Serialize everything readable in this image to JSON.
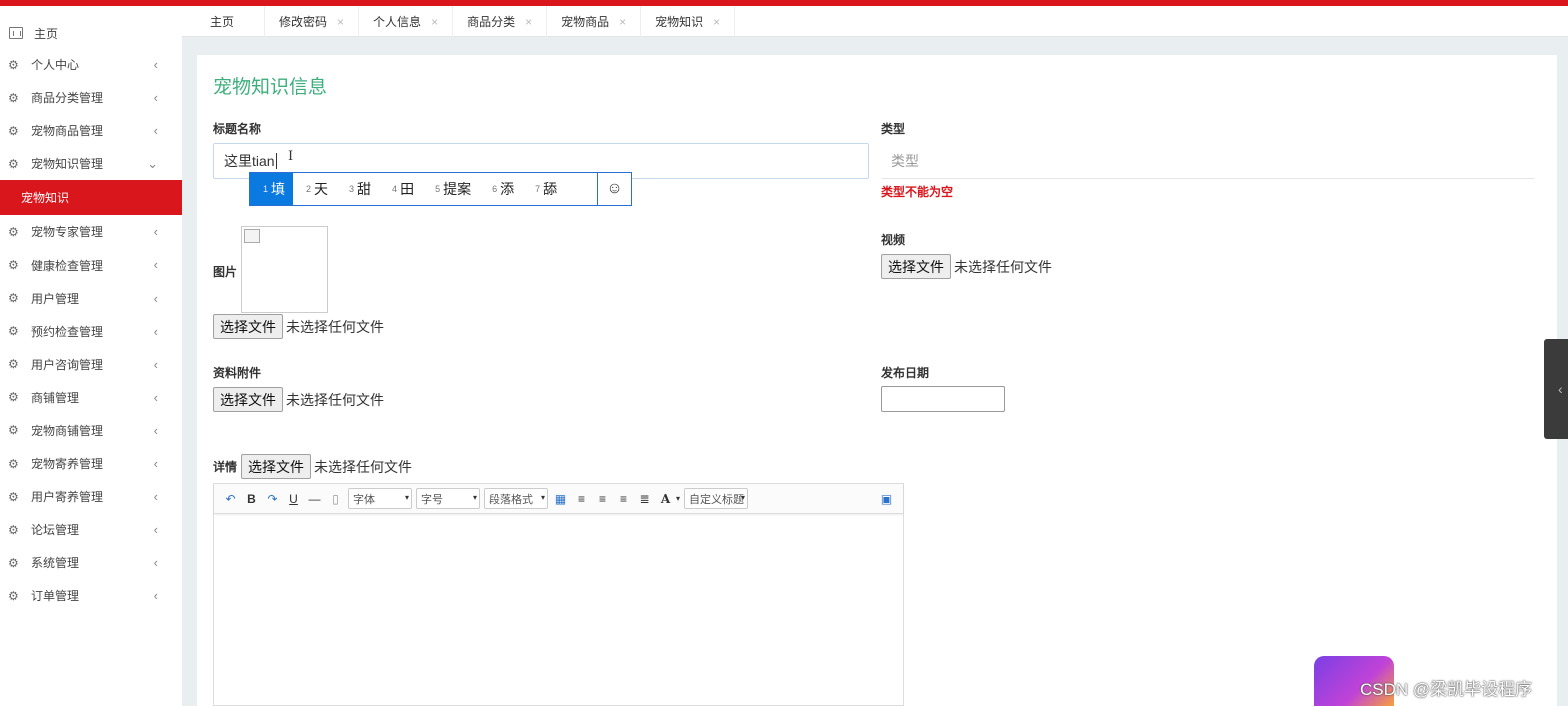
{
  "colors": {
    "accent_red": "#d9161c",
    "title_green": "#3eaf7c",
    "main_bg": "#e9eef0",
    "ime_blue": "#0b7ae0"
  },
  "sidebar": {
    "home": {
      "label": "主页",
      "icon": "dashboard-icon"
    },
    "items": [
      {
        "label": "个人中心",
        "icon": "gear-icon",
        "chevron": "chevron-left-icon"
      },
      {
        "label": "商品分类管理",
        "icon": "gear-icon",
        "chevron": "chevron-left-icon"
      },
      {
        "label": "宠物商品管理",
        "icon": "gear-icon",
        "chevron": "chevron-left-icon"
      },
      {
        "label": "宠物知识管理",
        "icon": "gear-icon",
        "chevron": "chevron-down-icon"
      },
      {
        "label": "宠物知识",
        "sub": true
      },
      {
        "label": "宠物专家管理",
        "icon": "gear-icon",
        "chevron": "chevron-left-icon"
      },
      {
        "label": "健康检查管理",
        "icon": "gear-icon",
        "chevron": "chevron-left-icon"
      },
      {
        "label": "用户管理",
        "icon": "gear-icon",
        "chevron": "chevron-left-icon"
      },
      {
        "label": "预约检查管理",
        "icon": "gear-icon",
        "chevron": "chevron-left-icon"
      },
      {
        "label": "用户咨询管理",
        "icon": "gear-icon",
        "chevron": "chevron-left-icon"
      },
      {
        "label": "商铺管理",
        "icon": "gear-icon",
        "chevron": "chevron-left-icon"
      },
      {
        "label": "宠物商铺管理",
        "icon": "gear-icon",
        "chevron": "chevron-left-icon"
      },
      {
        "label": "宠物寄养管理",
        "icon": "gear-icon",
        "chevron": "chevron-left-icon"
      },
      {
        "label": "用户寄养管理",
        "icon": "gear-icon",
        "chevron": "chevron-left-icon"
      },
      {
        "label": "论坛管理",
        "icon": "gear-icon",
        "chevron": "chevron-left-icon"
      },
      {
        "label": "系统管理",
        "icon": "gear-icon",
        "chevron": "chevron-left-icon"
      },
      {
        "label": "订单管理",
        "icon": "gear-icon",
        "chevron": "chevron-left-icon"
      }
    ]
  },
  "tabs": [
    {
      "label": "主页",
      "closable": false
    },
    {
      "label": "修改密码",
      "closable": true
    },
    {
      "label": "个人信息",
      "closable": true
    },
    {
      "label": "商品分类",
      "closable": true
    },
    {
      "label": "宠物商品",
      "closable": true
    },
    {
      "label": "宠物知识",
      "closable": true
    }
  ],
  "form": {
    "title": "宠物知识信息",
    "title_name": {
      "label": "标题名称",
      "value": "这里tian"
    },
    "type": {
      "label": "类型",
      "placeholder": "类型",
      "error": "类型不能为空"
    },
    "image": {
      "label": "图片"
    },
    "video": {
      "label": "视频"
    },
    "attachment": {
      "label": "资料附件"
    },
    "publish_date": {
      "label": "发布日期",
      "value": ""
    },
    "detail": {
      "label": "详情"
    },
    "file_button": "选择文件",
    "file_none": "未选择任何文件"
  },
  "ime": {
    "candidates": [
      {
        "n": "1",
        "text": "填"
      },
      {
        "n": "2",
        "text": "天"
      },
      {
        "n": "3",
        "text": "甜"
      },
      {
        "n": "4",
        "text": "田"
      },
      {
        "n": "5",
        "text": "提案"
      },
      {
        "n": "6",
        "text": "添"
      },
      {
        "n": "7",
        "text": "舔"
      }
    ],
    "emoji": "☺"
  },
  "editor": {
    "font_family": "字体",
    "font_size": "字号",
    "paragraph": "段落格式",
    "custom_title": "自定义标题"
  },
  "watermark": "CSDN @梁凯毕设程序"
}
